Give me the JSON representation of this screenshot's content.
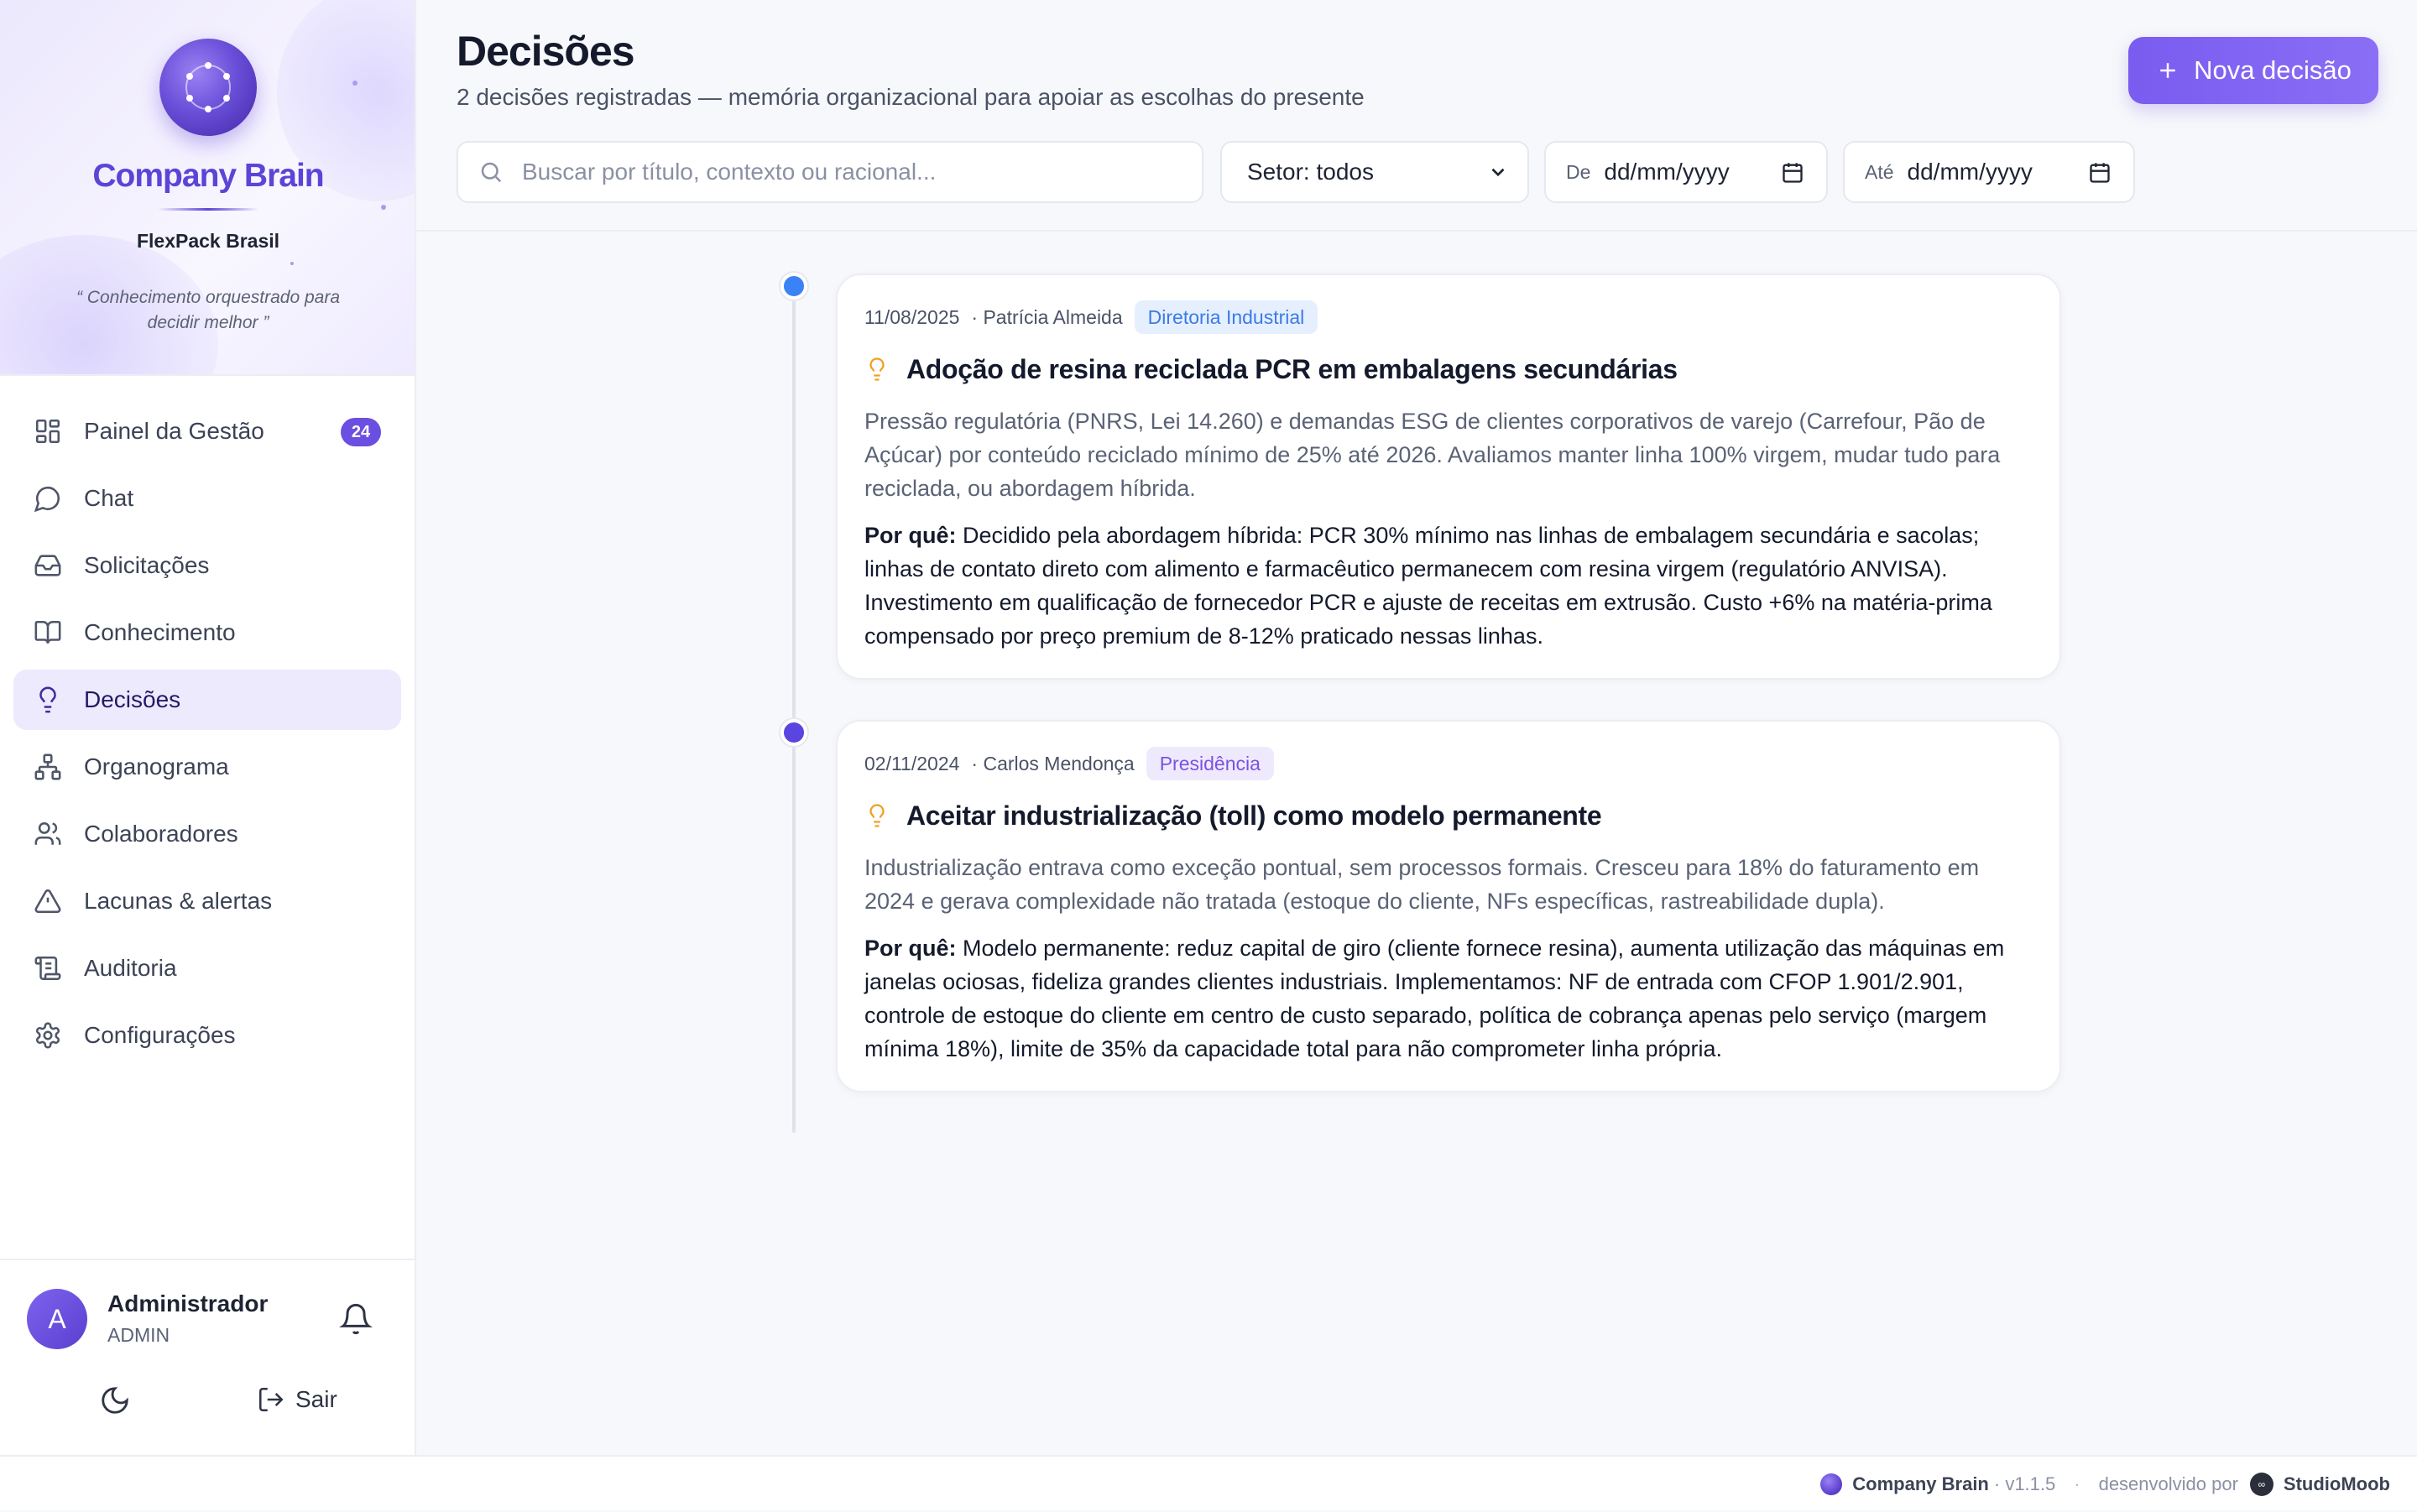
{
  "brand": {
    "name": "Company Brain",
    "company": "FlexPack Brasil",
    "tagline": "“ Conhecimento orquestrado para decidir melhor ”"
  },
  "sidebar": {
    "items": [
      {
        "label": "Painel da Gestão",
        "icon": "dashboard-icon",
        "badge": "24"
      },
      {
        "label": "Chat",
        "icon": "chat-icon"
      },
      {
        "label": "Solicitações",
        "icon": "inbox-icon"
      },
      {
        "label": "Conhecimento",
        "icon": "book-icon"
      },
      {
        "label": "Decisões",
        "icon": "lightbulb-icon",
        "active": true
      },
      {
        "label": "Organograma",
        "icon": "org-chart-icon"
      },
      {
        "label": "Colaboradores",
        "icon": "users-icon"
      },
      {
        "label": "Lacunas & alertas",
        "icon": "alert-triangle-icon"
      },
      {
        "label": "Auditoria",
        "icon": "scroll-icon"
      },
      {
        "label": "Configurações",
        "icon": "gear-icon"
      }
    ]
  },
  "user": {
    "initial": "A",
    "name": "Administrador",
    "role": "ADMIN",
    "logout_label": "Sair"
  },
  "header": {
    "title": "Decisões",
    "subtitle": "2 decisões registradas — memória organizacional para apoiar as escolhas do presente",
    "new_button": "Nova decisão"
  },
  "filters": {
    "search_placeholder": "Buscar por título, contexto ou racional...",
    "sector_value": "Setor: todos",
    "from_label": "De",
    "from_value": "dd/mm/yyyy",
    "to_label": "Até",
    "to_value": "dd/mm/yyyy"
  },
  "decisions": [
    {
      "date": "11/08/2025",
      "author": "· Patrícia Almeida",
      "tag": "Diretoria Industrial",
      "tag_color": "#3b7be8",
      "tag_bg": "#e6effd",
      "dot_color": "#3b82f6",
      "title": "Adoção de resina reciclada PCR em embalagens secundárias",
      "context": "Pressão regulatória (PNRS, Lei 14.260) e demandas ESG de clientes corporativos de varejo (Carrefour, Pão de Açúcar) por conteúdo reciclado mínimo de 25% até 2026. Avaliamos manter linha 100% virgem, mudar tudo para reciclada, ou abordagem híbrida.",
      "why_label": "Por quê:",
      "why": "Decidido pela abordagem híbrida: PCR 30% mínimo nas linhas de embalagem secundária e sacolas; linhas de contato direto com alimento e farmacêutico permanecem com resina virgem (regulatório ANVISA). Investimento em qualificação de fornecedor PCR e ajuste de receitas em extrusão. Custo +6% na matéria-prima compensado por preço premium de 8-12% praticado nessas linhas."
    },
    {
      "date": "02/11/2024",
      "author": "· Carlos Mendonça",
      "tag": "Presidência",
      "tag_color": "#7b52e0",
      "tag_bg": "#efe9fd",
      "dot_color": "#5b45e0",
      "title": "Aceitar industrialização (toll) como modelo permanente",
      "context": "Industrialização entrava como exceção pontual, sem processos formais. Cresceu para 18% do faturamento em 2024 e gerava complexidade não tratada (estoque do cliente, NFs específicas, rastreabilidade dupla).",
      "why_label": "Por quê:",
      "why": "Modelo permanente: reduz capital de giro (cliente fornece resina), aumenta utilização das máquinas em janelas ociosas, fideliza grandes clientes industriais. Implementamos: NF de entrada com CFOP 1.901/2.901, controle de estoque do cliente em centro de custo separado, política de cobrança apenas pelo serviço (margem mínima 18%), limite de 35% da capacidade total para não comprometer linha própria."
    }
  ],
  "footer": {
    "app": "Company Brain",
    "version": "· v1.1.5",
    "separator": "·",
    "dev_label": "desenvolvido por",
    "studio": "StudioMoob"
  }
}
